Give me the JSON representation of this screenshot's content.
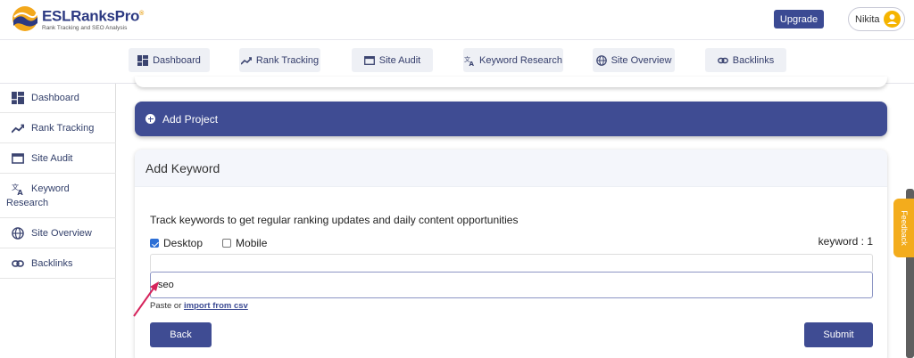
{
  "brand": {
    "name": "ESLRanksPro",
    "trademark": "®",
    "tagline": "Rank Tracking and SEO Analysis",
    "accent": "#3f4c93",
    "highlight": "#f3ac1c"
  },
  "header": {
    "upgrade_label": "Upgrade",
    "user_name": "Nikita",
    "avatar_icon": "user-avatar-icon"
  },
  "topnav": {
    "items": [
      {
        "label": "Dashboard",
        "icon": "dashboard-icon"
      },
      {
        "label": "Rank Tracking",
        "icon": "trend-icon"
      },
      {
        "label": "Site Audit",
        "icon": "browser-icon"
      },
      {
        "label": "Keyword Research",
        "icon": "translate-icon"
      },
      {
        "label": "Site Overview",
        "icon": "globe-icon"
      },
      {
        "label": "Backlinks",
        "icon": "link-icon"
      }
    ]
  },
  "sidebar": {
    "items": [
      {
        "label": "Dashboard",
        "icon": "dashboard-icon"
      },
      {
        "label": "Rank Tracking",
        "icon": "trend-icon"
      },
      {
        "label": "Site Audit",
        "icon": "browser-icon"
      },
      {
        "label": "Keyword",
        "label_line2": "Research",
        "icon": "translate-icon"
      },
      {
        "label": "Site Overview",
        "icon": "globe-icon"
      },
      {
        "label": "Backlinks",
        "icon": "link-icon"
      }
    ]
  },
  "main": {
    "add_project_label": "Add Project",
    "add_keyword": {
      "title": "Add Keyword",
      "description": "Track keywords to get regular ranking updates and daily content opportunities",
      "desktop_label": "Desktop",
      "desktop_checked": true,
      "mobile_label": "Mobile",
      "mobile_checked": false,
      "keyword_count": "keyword : 1",
      "input_value": "seo",
      "paste_prefix": "Paste or ",
      "import_link": "import from csv",
      "back_label": "Back",
      "submit_label": "Submit"
    }
  },
  "feedback_label": "Feedback"
}
